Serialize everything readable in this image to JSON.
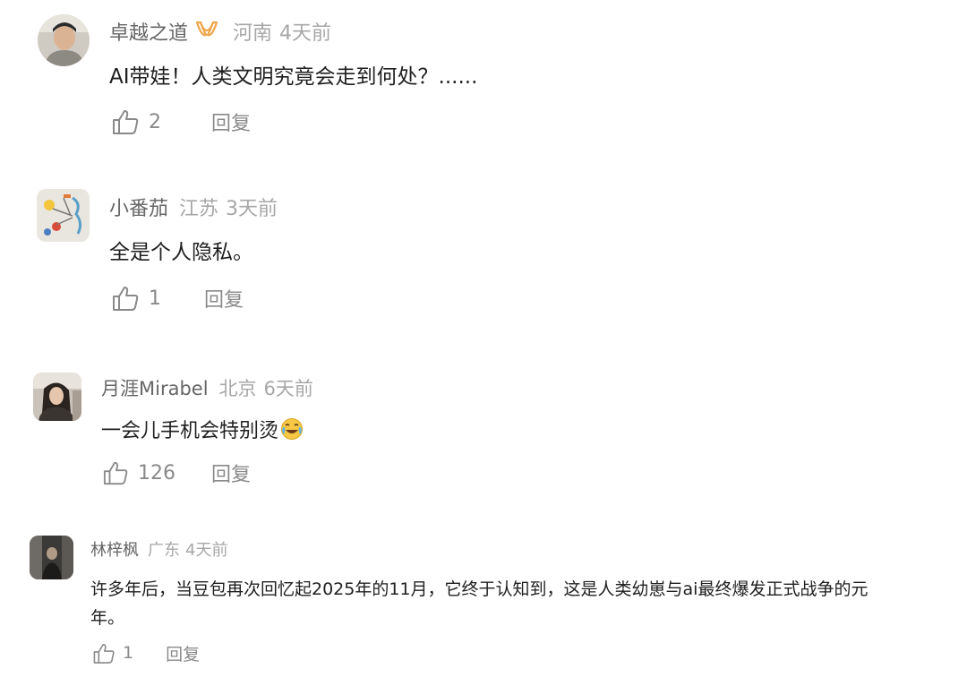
{
  "comments": [
    {
      "name": "卓越之道",
      "badge_icon": "double-v-badge-icon",
      "location": "河南",
      "time": "4天前",
      "text": "AI带娃！人类文明究竟会走到何处？......",
      "likes": "2",
      "reply_label": "回复"
    },
    {
      "name": "小番茄",
      "location": "江苏",
      "time": "3天前",
      "text": "全是个人隐私。",
      "likes": "1",
      "reply_label": "回复"
    },
    {
      "name": "月涯Mirabel",
      "location": "北京",
      "time": "6天前",
      "text": "一会儿手机会特别烫",
      "emoji_icon": "laughing-crying-emoji-icon",
      "likes": "126",
      "reply_label": "回复"
    },
    {
      "name": "林梓枫",
      "location": "广东",
      "time": "4天前",
      "text": "许多年后，当豆包再次回忆起2025年的11月，它终于认知到，这是人类幼崽与ai最终爆发正式战争的元年。",
      "likes": "1",
      "reply_label": "回复"
    }
  ],
  "colors": {
    "name": "#666666",
    "meta": "#a7a7a7",
    "text": "#1f1f1f",
    "action": "#8a8a8a",
    "badge": "#f0a64a"
  }
}
